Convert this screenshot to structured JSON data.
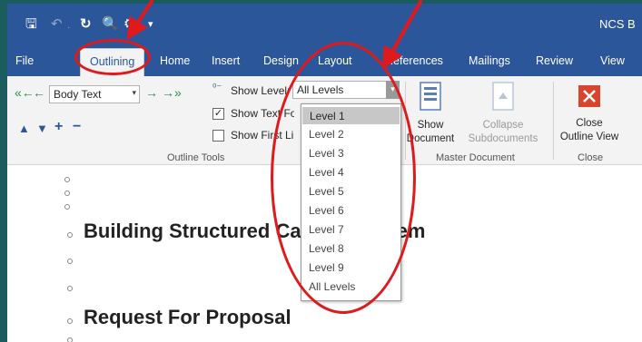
{
  "title_bar": {
    "doc_title": "NCS B"
  },
  "tabs": [
    {
      "label": "File"
    },
    {
      "label": "Outlining"
    },
    {
      "label": "Home"
    },
    {
      "label": "Insert"
    },
    {
      "label": "Design"
    },
    {
      "label": "Layout"
    },
    {
      "label": "References"
    },
    {
      "label": "Mailings"
    },
    {
      "label": "Review"
    },
    {
      "label": "View"
    }
  ],
  "outline_tools": {
    "style_select": "Body Text",
    "show_level_label": "Show Level:",
    "show_level_value": "All Levels",
    "show_text_formatting": "Show Text Formatting",
    "show_text_formatting_checked": true,
    "show_first_line_only": "Show First Line Only",
    "show_first_line_checked": false,
    "group_label": "Outline Tools"
  },
  "master_document": {
    "show_document": [
      "Show",
      "Document"
    ],
    "collapse_subdocuments": [
      "Collapse",
      "Subdocuments"
    ],
    "group_label": "Master Document"
  },
  "close_group": {
    "close_outline_view": [
      "Close",
      "Outline View"
    ],
    "group_label": "Close"
  },
  "level_options": [
    "Level 1",
    "Level 2",
    "Level 3",
    "Level 4",
    "Level 5",
    "Level 6",
    "Level 7",
    "Level 8",
    "Level 9",
    "All Levels"
  ],
  "highlighted_option": "Level 1",
  "document": {
    "heading1": "Building Structured Cabling System",
    "heading2": "Request For Proposal"
  },
  "colors": {
    "ribbon_blue": "#2b579a",
    "annotation_red": "#e0191c",
    "background": "#1b5c5e"
  }
}
